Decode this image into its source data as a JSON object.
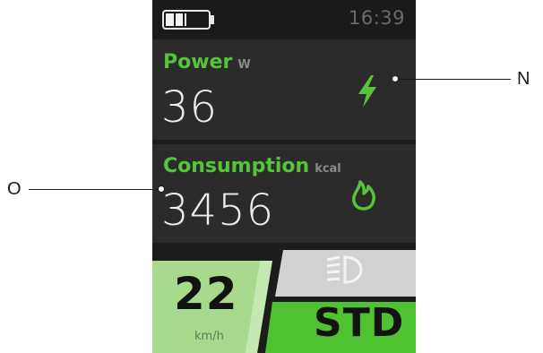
{
  "status_bar": {
    "time": "16:39",
    "battery_level_fraction": 0.5
  },
  "power": {
    "label": "Power",
    "unit": "W",
    "value": "36",
    "icon": "lightning-bolt-icon"
  },
  "consumption": {
    "label": "Consumption",
    "unit": "kcal",
    "value": "3456",
    "icon": "flame-icon"
  },
  "speed": {
    "value": "22",
    "unit": "km/h"
  },
  "light": {
    "icon": "headlight-icon"
  },
  "mode": {
    "label": "STD"
  },
  "callouts": {
    "right_label": "N",
    "left_label": "O"
  },
  "colors": {
    "accent_green": "#56c43a",
    "panel_bg": "#2b2b2b",
    "screen_bg": "#1c1c1c",
    "speed_bg": "#a6d98a",
    "mode_bg": "#4fc231"
  }
}
